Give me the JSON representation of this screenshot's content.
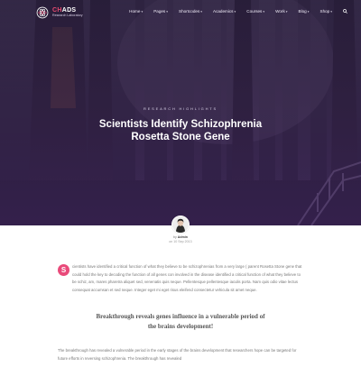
{
  "brand": {
    "name_accent": "CH",
    "name_rest": "ADS",
    "subtitle": "Research Laboratory",
    "accent_color": "#e34a6f"
  },
  "nav": {
    "items": [
      {
        "label": "Home",
        "has_dropdown": true
      },
      {
        "label": "Pages",
        "has_dropdown": true
      },
      {
        "label": "Shortcodes",
        "has_dropdown": true
      },
      {
        "label": "Academics",
        "has_dropdown": true
      },
      {
        "label": "Courses",
        "has_dropdown": true
      },
      {
        "label": "Work",
        "has_dropdown": true
      },
      {
        "label": "Blog",
        "has_dropdown": true
      },
      {
        "label": "Shop",
        "has_dropdown": true
      }
    ],
    "search_icon": "search-icon"
  },
  "hero": {
    "kicker": "Research Highlights",
    "title": "Scientists Identify Schizophrenia Rosetta Stone Gene"
  },
  "author": {
    "by_prefix": "by",
    "name": "Admin",
    "date": "on 10 Sep 2013"
  },
  "article": {
    "dropcap": "S",
    "paragraph1": "cientists have identified a critical function of what they believe to be schizophrenias from a very large ( parent Rosetta Stone gene that could hold the key to decoding the function of all genes con involved in the disease identified a critical function of what they believe to be schiz, am, mares pharetra aliquet sed, venenatis quis neque. Pellentesque pellentesque iaculis porta. Nam quis odio vitae lectus consequat accumsan et sed neque. Integer eget mi eget risus eleifend consectetur vehicula sit amet neque.",
    "pull_quote": "Breakthrough reveals genes influence in a vulnerable period of the brains development!",
    "paragraph2": "The breakthrough has revealed a vulnerable period in the early stages of the brains development that researchers hope can be targeted for future efforts in reversing schizophrenia. The breakthrough has revealed"
  }
}
